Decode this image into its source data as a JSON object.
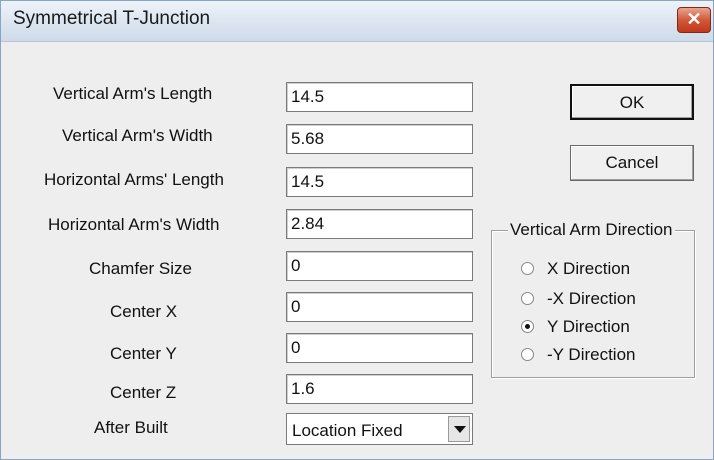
{
  "dialog": {
    "title": "Symmetrical T-Junction",
    "close_symbol": "✕"
  },
  "fields": [
    {
      "label": "Vertical Arm's Length",
      "value": "14.5"
    },
    {
      "label": "Vertical Arm's Width",
      "value": "5.68"
    },
    {
      "label": "Horizontal Arms' Length",
      "value": "14.5"
    },
    {
      "label": "Horizontal Arm's Width",
      "value": "2.84"
    },
    {
      "label": "Chamfer Size",
      "value": "0"
    },
    {
      "label": "Center X",
      "value": "0"
    },
    {
      "label": "Center Y",
      "value": "0"
    },
    {
      "label": "Center Z",
      "value": "1.6"
    }
  ],
  "after_built": {
    "label": "After Built",
    "selected": "Location Fixed"
  },
  "buttons": {
    "ok": "OK",
    "cancel": "Cancel"
  },
  "direction_group": {
    "title": "Vertical Arm Direction",
    "options": [
      {
        "label": "X Direction",
        "checked": false
      },
      {
        "label": "-X Direction",
        "checked": false
      },
      {
        "label": "Y Direction",
        "checked": true
      },
      {
        "label": "-Y Direction",
        "checked": false
      }
    ]
  }
}
